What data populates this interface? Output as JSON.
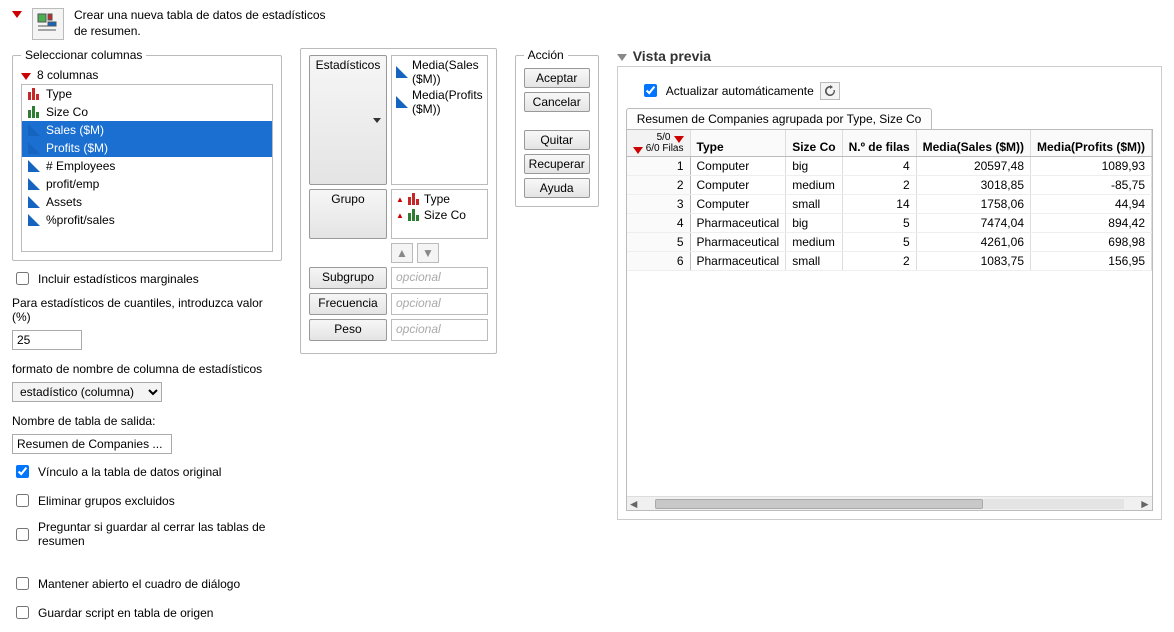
{
  "header": {
    "text": "Crear una nueva tabla de datos de estadísticos de resumen."
  },
  "select_columns": {
    "legend": "Seleccionar columnas",
    "count_label": "8 columnas",
    "items": [
      {
        "label": "Type",
        "icon": "bars-red",
        "selected": false
      },
      {
        "label": "Size Co",
        "icon": "bars-green",
        "selected": false
      },
      {
        "label": "Sales ($M)",
        "icon": "tri",
        "selected": true
      },
      {
        "label": "Profits ($M)",
        "icon": "tri",
        "selected": true
      },
      {
        "label": "# Employees",
        "icon": "tri",
        "selected": false
      },
      {
        "label": "profit/emp",
        "icon": "tri",
        "selected": false
      },
      {
        "label": "Assets",
        "icon": "tri",
        "selected": false
      },
      {
        "label": "%profit/sales",
        "icon": "tri",
        "selected": false
      }
    ]
  },
  "options": {
    "include_marginal": {
      "label": "Incluir estadísticos marginales",
      "checked": false
    },
    "quantile_label": "Para estadísticos de cuantiles, introduzca valor (%)",
    "quantile_value": "25",
    "name_format_label": "formato de nombre de columna de estadísticos",
    "name_format_value": "estadístico (columna)",
    "out_name_label": "Nombre de tabla de salida:",
    "out_name_value": "Resumen de Companies ...",
    "link_original": {
      "label": "Vínculo a la tabla de datos original",
      "checked": true
    },
    "remove_excluded": {
      "label": "Eliminar grupos excluidos",
      "checked": false
    },
    "ask_save": {
      "label": "Preguntar si guardar al cerrar las tablas de resumen",
      "checked": false
    },
    "keep_open": {
      "label": "Mantener abierto el cuadro de diálogo",
      "checked": false
    },
    "save_script": {
      "label": "Guardar script en tabla de origen",
      "checked": false
    }
  },
  "roles": {
    "stats_btn": "Estadísticos",
    "stats_items": [
      "Media(Sales ($M))",
      "Media(Profits ($M))"
    ],
    "group_btn": "Grupo",
    "group_items": [
      {
        "label": "Type",
        "icon": "bars-red"
      },
      {
        "label": "Size Co",
        "icon": "bars-green"
      }
    ],
    "subgroup_btn": "Subgrupo",
    "freq_btn": "Frecuencia",
    "weight_btn": "Peso",
    "optional_placeholder": "opcional"
  },
  "actions": {
    "legend": "Acción",
    "accept": "Aceptar",
    "cancel": "Cancelar",
    "remove": "Quitar",
    "recover": "Recuperar",
    "help": "Ayuda"
  },
  "preview": {
    "title": "Vista previa",
    "auto_label": "Actualizar automáticamente",
    "auto_checked": true,
    "tab": "Resumen de Companies agrupada por Type, Size Co",
    "corner_top": "5/0",
    "corner_bottom": "6/0 Filas",
    "headers": [
      "Type",
      "Size Co",
      "N.º de filas",
      "Media(Sales ($M))",
      "Media(Profits ($M))"
    ],
    "rows": [
      {
        "n": "1",
        "type": "Computer",
        "size": "big",
        "nrows": "4",
        "sales": "20597,48",
        "profits": "1089,93"
      },
      {
        "n": "2",
        "type": "Computer",
        "size": "medium",
        "nrows": "2",
        "sales": "3018,85",
        "profits": "-85,75"
      },
      {
        "n": "3",
        "type": "Computer",
        "size": "small",
        "nrows": "14",
        "sales": "1758,06",
        "profits": "44,94"
      },
      {
        "n": "4",
        "type": "Pharmaceutical",
        "size": "big",
        "nrows": "5",
        "sales": "7474,04",
        "profits": "894,42"
      },
      {
        "n": "5",
        "type": "Pharmaceutical",
        "size": "medium",
        "nrows": "5",
        "sales": "4261,06",
        "profits": "698,98"
      },
      {
        "n": "6",
        "type": "Pharmaceutical",
        "size": "small",
        "nrows": "2",
        "sales": "1083,75",
        "profits": "156,95"
      }
    ]
  }
}
